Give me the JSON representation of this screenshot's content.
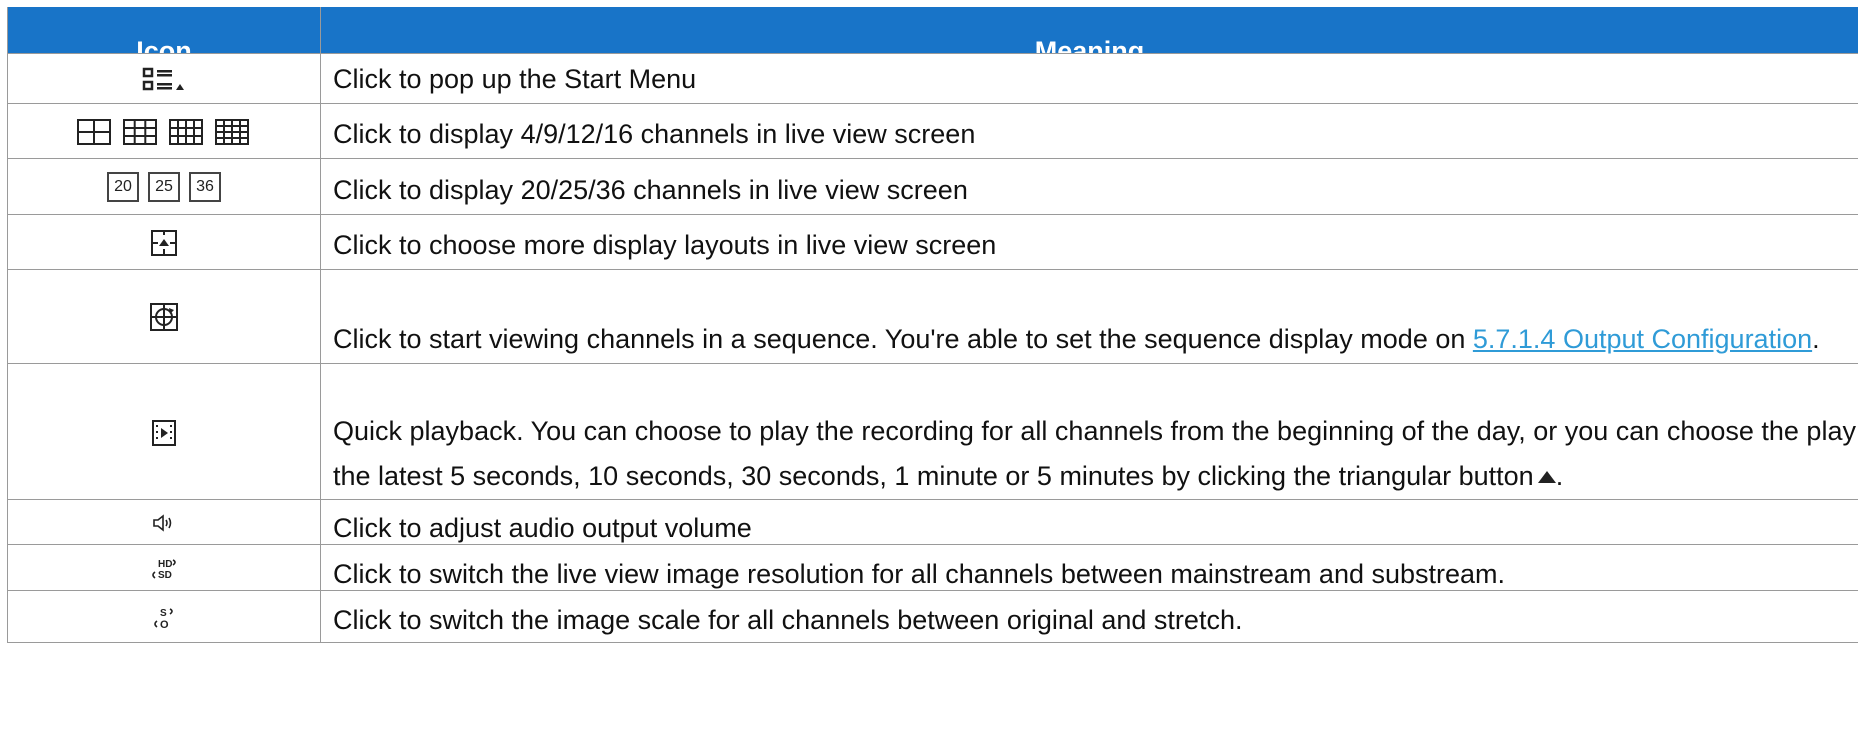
{
  "header": {
    "icon": "Icon",
    "meaning": "Meaning"
  },
  "rows": [
    {
      "icon": "start-menu-icon",
      "meaning": "Click to pop up the Start Menu"
    },
    {
      "icon": "grid-layouts-icon",
      "meaning": "Click to display 4/9/12/16 channels in live view screen"
    },
    {
      "icon": "channel-count-icon",
      "labels": [
        "20",
        "25",
        "36"
      ],
      "meaning": "Click to display 20/25/36 channels in live view screen"
    },
    {
      "icon": "more-layouts-icon",
      "meaning": "Click to choose more display layouts in live view screen"
    },
    {
      "icon": "sequence-icon",
      "meaning_before": "Click to start viewing channels in a sequence. You're able to set the sequence display mode on ",
      "link": "5.7.1.4 Output Configuration",
      "meaning_after": "."
    },
    {
      "icon": "quick-playback-icon",
      "meaning": "Quick playback. You can choose to play the recording for all channels from the beginning of the day, or you can choose the play the latest 5 seconds, 10 seconds, 30 seconds, 1 minute or 5 minutes by clicking the triangular button",
      "meaning_after": "."
    },
    {
      "icon": "audio-volume-icon",
      "meaning": "Click to adjust audio output volume"
    },
    {
      "icon": "hd-sd-switch-icon",
      "meaning": "Click to switch the live view image resolution for all channels between mainstream and substream."
    },
    {
      "icon": "scale-switch-icon",
      "meaning": "Click to switch the image scale for all channels between original and stretch."
    }
  ],
  "colors": {
    "header_bg": "#1874c8",
    "link": "#2f9bd7",
    "border": "#9a9a9a"
  }
}
